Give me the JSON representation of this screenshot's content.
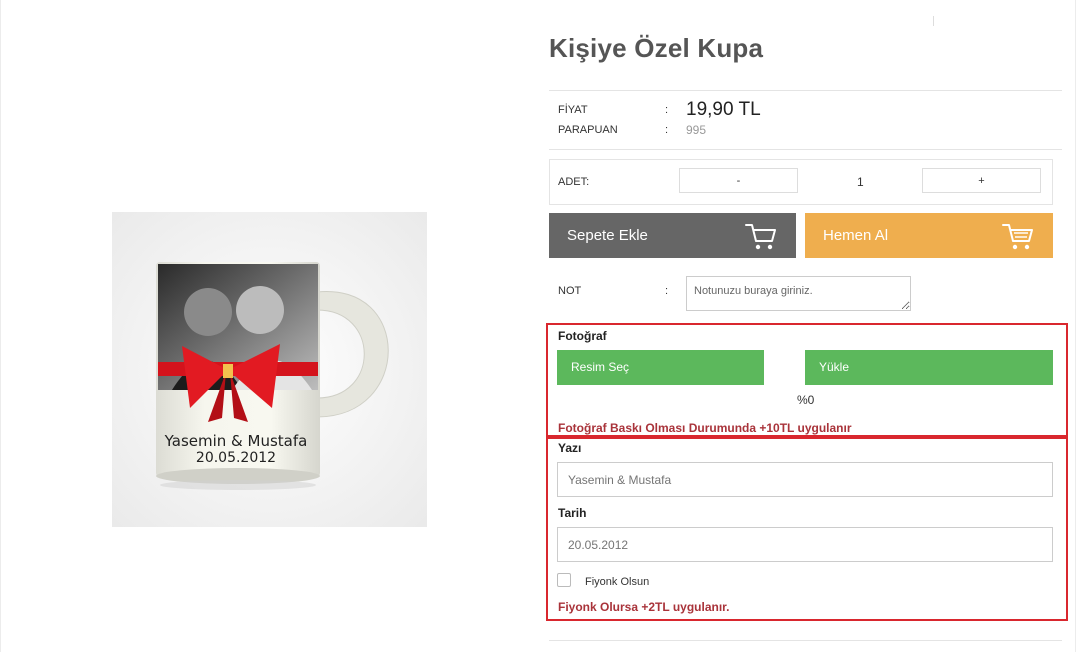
{
  "product": {
    "title": "Kişiye Özel Kupa",
    "image_caption_names": "Yasemin & Mustafa",
    "image_caption_date": "20.05.2012"
  },
  "pricing": {
    "price_label": "FİYAT",
    "price_value": "19,90 TL",
    "points_label": "PARAPUAN",
    "points_value": "995",
    "separator": ":"
  },
  "quantity": {
    "label": "ADET:",
    "minus": "-",
    "value": "1",
    "plus": "+"
  },
  "actions": {
    "add_to_cart": "Sepete Ekle",
    "buy_now": "Hemen Al"
  },
  "note": {
    "label": "NOT",
    "separator": ":",
    "placeholder": "Notunuzu buraya giriniz."
  },
  "photo_section": {
    "label": "Fotoğraf",
    "choose_button": "Resim Seç",
    "upload_button": "Yükle",
    "progress_text": "%0",
    "notice": "Fotoğraf Baskı Olması Durumunda +10TL uygulanır"
  },
  "text_section": {
    "text_label": "Yazı",
    "text_placeholder": "Yasemin & Mustafa",
    "date_label": "Tarih",
    "date_placeholder": "20.05.2012",
    "bow_checkbox_label": "Fiyonk Olsun",
    "bow_checked": false,
    "notice": "Fiyonk Olursa +2TL uygulanır."
  },
  "colors": {
    "cart_button": "#666666",
    "buy_button": "#efae4e",
    "green_button": "#5cb85c",
    "highlight_border": "#d9272e",
    "notice_text": "#a9333a"
  },
  "icons": {
    "cart": "shopping-cart-icon",
    "buy": "fast-cart-icon"
  }
}
